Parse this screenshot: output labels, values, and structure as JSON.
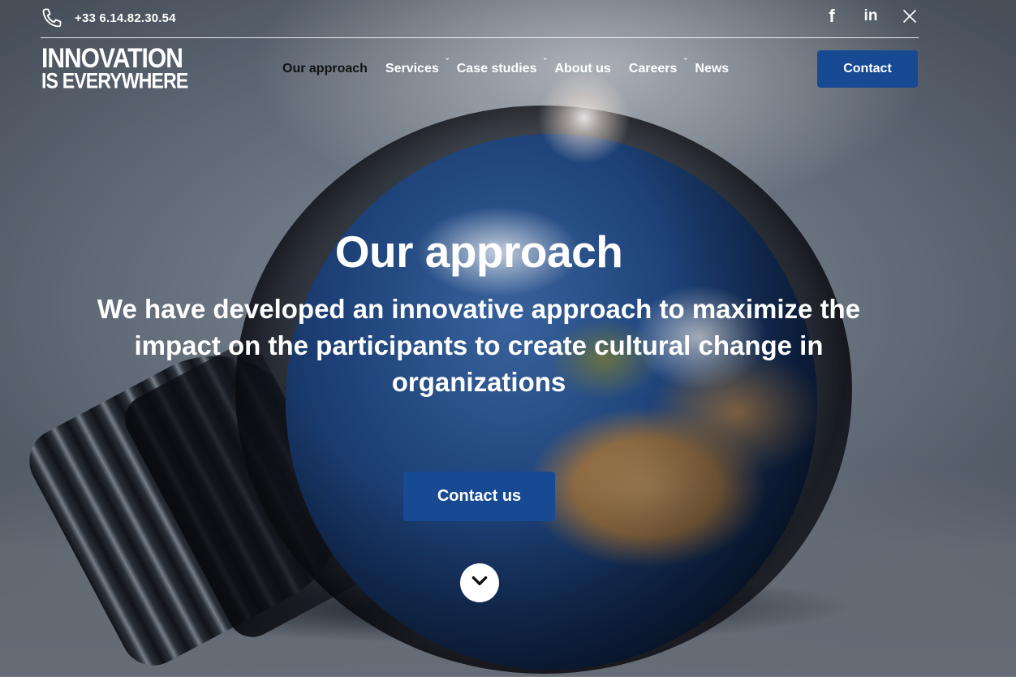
{
  "topbar": {
    "phone": "+33 6.14.82.30.54",
    "socials": [
      {
        "name": "facebook-icon",
        "glyph": "f"
      },
      {
        "name": "linkedin-icon",
        "glyph": "in"
      },
      {
        "name": "x-twitter-icon",
        "glyph": "𝕏"
      }
    ]
  },
  "logo": {
    "line1": "INNOVATION",
    "line2": "IS EVERYWHERE"
  },
  "nav": {
    "items": [
      {
        "label": "Our approach",
        "active": true
      },
      {
        "label": "Services",
        "dropdown": true
      },
      {
        "label": "Case studies",
        "dropdown": true
      },
      {
        "label": "About us"
      },
      {
        "label": "Careers",
        "dropdown": true
      },
      {
        "label": "News"
      }
    ],
    "contact_label": "Contact",
    "dropdown_glyph": "ˇ"
  },
  "hero": {
    "title": "Our approach",
    "subtitle": "We have developed an innovative approach to maximize the impact on the participants to create cultural change in organizations",
    "cta_label": "Contact us"
  },
  "colors": {
    "accent": "#174a93",
    "active_nav": "#111111",
    "text": "#ffffff"
  },
  "icons": {
    "phone": "phone-icon",
    "scroll": "chevron-down-icon"
  }
}
